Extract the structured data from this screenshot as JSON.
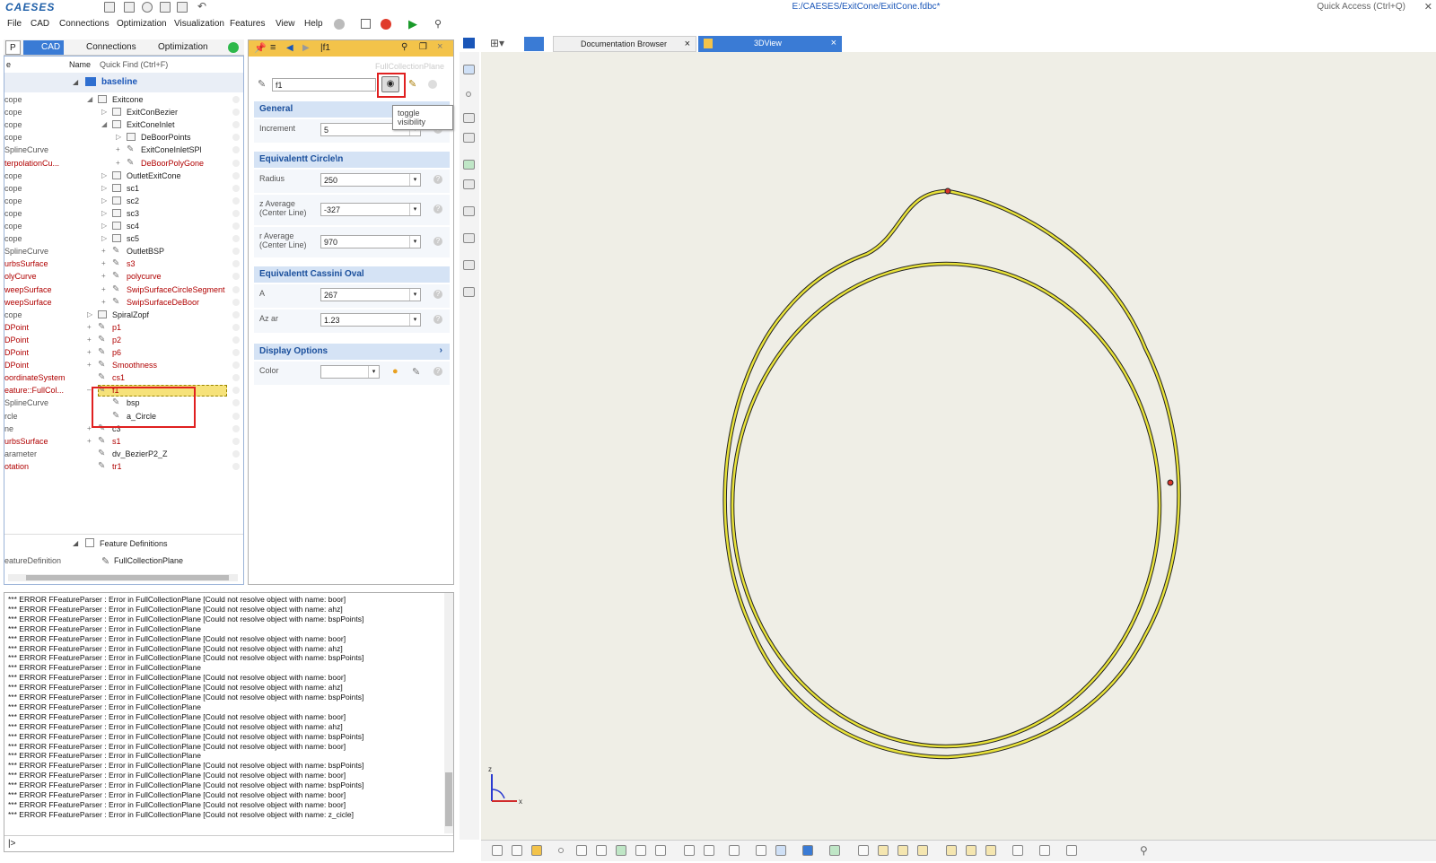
{
  "app": {
    "logo": "CAESES",
    "title": "E:/CAESES/ExitCone/ExitCone.fdbc*",
    "quick_access": "Quick Access (Ctrl+Q)"
  },
  "menu": [
    "File",
    "CAD",
    "Connections",
    "Optimization",
    "Visualization",
    "Features",
    "View",
    "Help"
  ],
  "left_tabs": {
    "p": "P",
    "cad": "CAD",
    "connections": "Connections",
    "optimization": "Optimization"
  },
  "tree": {
    "col_type": "e",
    "col_name": "Name",
    "quick_find": "Quick Find (Ctrl+F)",
    "root": "baseline",
    "rows": [
      {
        "type": "cope",
        "name": "Exitcone",
        "indent": 0,
        "exp": "◢",
        "red": false,
        "folder": true
      },
      {
        "type": "cope",
        "name": "ExitConBezier",
        "indent": 1,
        "exp": "▷",
        "red": false,
        "folder": true
      },
      {
        "type": "cope",
        "name": "ExitConeInlet",
        "indent": 1,
        "exp": "◢",
        "red": false,
        "folder": true
      },
      {
        "type": "cope",
        "name": "DeBoorPoints",
        "indent": 2,
        "exp": "▷",
        "red": false,
        "folder": true
      },
      {
        "type": "SplineCurve",
        "name": "ExitConeInletSPl",
        "indent": 2,
        "exp": "+",
        "red": false,
        "folder": false
      },
      {
        "type": "terpolationCu...",
        "name": "DeBoorPolyGone",
        "indent": 2,
        "exp": "+",
        "red": true,
        "folder": false
      },
      {
        "type": "cope",
        "name": "OutletExitCone",
        "indent": 1,
        "exp": "▷",
        "red": false,
        "folder": true
      },
      {
        "type": "cope",
        "name": "sc1",
        "indent": 1,
        "exp": "▷",
        "red": false,
        "folder": true
      },
      {
        "type": "cope",
        "name": "sc2",
        "indent": 1,
        "exp": "▷",
        "red": false,
        "folder": true
      },
      {
        "type": "cope",
        "name": "sc3",
        "indent": 1,
        "exp": "▷",
        "red": false,
        "folder": true
      },
      {
        "type": "cope",
        "name": "sc4",
        "indent": 1,
        "exp": "▷",
        "red": false,
        "folder": true
      },
      {
        "type": "cope",
        "name": "sc5",
        "indent": 1,
        "exp": "▷",
        "red": false,
        "folder": true
      },
      {
        "type": "SplineCurve",
        "name": "OutletBSP",
        "indent": 1,
        "exp": "+",
        "red": false,
        "folder": false
      },
      {
        "type": "urbsSurface",
        "name": "s3",
        "indent": 1,
        "exp": "+",
        "red": true,
        "folder": false
      },
      {
        "type": "olyCurve",
        "name": "polycurve",
        "indent": 1,
        "exp": "+",
        "red": true,
        "folder": false
      },
      {
        "type": "weepSurface",
        "name": "SwipSurfaceCircleSegment",
        "indent": 1,
        "exp": "+",
        "red": true,
        "folder": false
      },
      {
        "type": "weepSurface",
        "name": "SwipSurfaceDeBoor",
        "indent": 1,
        "exp": "+",
        "red": true,
        "folder": false
      },
      {
        "type": "cope",
        "name": "SpiralZopf",
        "indent": 0,
        "exp": "▷",
        "red": false,
        "folder": true
      },
      {
        "type": "DPoint",
        "name": "p1",
        "indent": 0,
        "exp": "+",
        "red": true,
        "folder": false
      },
      {
        "type": "DPoint",
        "name": "p2",
        "indent": 0,
        "exp": "+",
        "red": true,
        "folder": false
      },
      {
        "type": "DPoint",
        "name": "p6",
        "indent": 0,
        "exp": "+",
        "red": true,
        "folder": false
      },
      {
        "type": "DPoint",
        "name": "Smoothness",
        "indent": 0,
        "exp": "+",
        "red": true,
        "folder": false
      },
      {
        "type": "oordinateSystem",
        "name": "cs1",
        "indent": 0,
        "exp": "",
        "red": true,
        "folder": false
      },
      {
        "type": "eature::FullCol...",
        "name": "f1",
        "indent": 0,
        "exp": "–",
        "red": true,
        "folder": false,
        "selected": true
      },
      {
        "type": "SplineCurve",
        "name": "bsp",
        "indent": 1,
        "exp": "",
        "red": false,
        "folder": false
      },
      {
        "type": "rcle",
        "name": "a_Circle",
        "indent": 1,
        "exp": "",
        "red": false,
        "folder": false
      },
      {
        "type": "ne",
        "name": "c3",
        "indent": 0,
        "exp": "+",
        "red": false,
        "folder": false
      },
      {
        "type": "urbsSurface",
        "name": "s1",
        "indent": 0,
        "exp": "+",
        "red": true,
        "folder": false
      },
      {
        "type": "arameter",
        "name": "dv_BezierP2_Z",
        "indent": 0,
        "exp": "",
        "red": false,
        "folder": false
      },
      {
        "type": "otation",
        "name": "tr1",
        "indent": 0,
        "exp": "",
        "red": true,
        "folder": false
      }
    ],
    "feature_definitions": "Feature Definitions",
    "fd_type": "eatureDefinition",
    "fd_name": "FullCollectionPlane"
  },
  "props": {
    "header": "|f1",
    "type_label": "FullCollectionPlane",
    "name_value": "f1",
    "tooltip": "toggle visibility",
    "general": "General",
    "increment_label": "Increment",
    "increment_value": "5",
    "circle_section": "Equivalentt Circle\\n",
    "radius_label": "Radius",
    "radius_value": "250",
    "zavg_label": "z Average (Center Line)",
    "zavg_value": "-327",
    "ravg_label": "r Average (Center Line)",
    "ravg_value": "970",
    "cassini_section": "Equivalentt Cassini Oval",
    "a_label": "A",
    "a_value": "267",
    "azar_label": "Az ar",
    "azar_value": "1.23",
    "display_section": "Display Options",
    "display_chevron": "›",
    "color_label": "Color",
    "help": "?"
  },
  "console": {
    "lines": [
      "*** ERROR FFeatureParser : Error in FullCollectionPlane [Could not resolve object with name: boor]",
      "*** ERROR FFeatureParser : Error in FullCollectionPlane [Could not resolve object with name: ahz]",
      "*** ERROR FFeatureParser : Error in FullCollectionPlane [Could not resolve object with name: bspPoints]",
      "*** ERROR FFeatureParser : Error in FullCollectionPlane",
      "*** ERROR FFeatureParser : Error in FullCollectionPlane [Could not resolve object with name: boor]",
      "*** ERROR FFeatureParser : Error in FullCollectionPlane [Could not resolve object with name: ahz]",
      "*** ERROR FFeatureParser : Error in FullCollectionPlane [Could not resolve object with name: bspPoints]",
      "*** ERROR FFeatureParser : Error in FullCollectionPlane",
      "*** ERROR FFeatureParser : Error in FullCollectionPlane [Could not resolve object with name: boor]",
      "*** ERROR FFeatureParser : Error in FullCollectionPlane [Could not resolve object with name: ahz]",
      "*** ERROR FFeatureParser : Error in FullCollectionPlane [Could not resolve object with name: bspPoints]",
      "*** ERROR FFeatureParser : Error in FullCollectionPlane",
      "*** ERROR FFeatureParser : Error in FullCollectionPlane [Could not resolve object with name: boor]",
      "*** ERROR FFeatureParser : Error in FullCollectionPlane [Could not resolve object with name: ahz]",
      "*** ERROR FFeatureParser : Error in FullCollectionPlane [Could not resolve object with name: bspPoints]",
      "*** ERROR FFeatureParser : Error in FullCollectionPlane [Could not resolve object with name: boor]",
      "*** ERROR FFeatureParser : Error in FullCollectionPlane",
      "*** ERROR FFeatureParser : Error in FullCollectionPlane [Could not resolve object with name: bspPoints]",
      "*** ERROR FFeatureParser : Error in FullCollectionPlane [Could not resolve object with name: boor]",
      "*** ERROR FFeatureParser : Error in FullCollectionPlane [Could not resolve object with name: bspPoints]",
      "*** ERROR FFeatureParser : Error in FullCollectionPlane [Could not resolve object with name: boor]",
      "*** ERROR FFeatureParser : Error in FullCollectionPlane [Could not resolve object with name: boor]",
      "*** ERROR FFeatureParser : Error in FullCollectionPlane [Could not resolve object with name: z_cicle]"
    ],
    "prompt": "|>"
  },
  "viewport": {
    "tab_docs": "Documentation Browser",
    "tab_3d": "3DView",
    "close": "×",
    "axis_z": "z",
    "axis_x": "x"
  }
}
